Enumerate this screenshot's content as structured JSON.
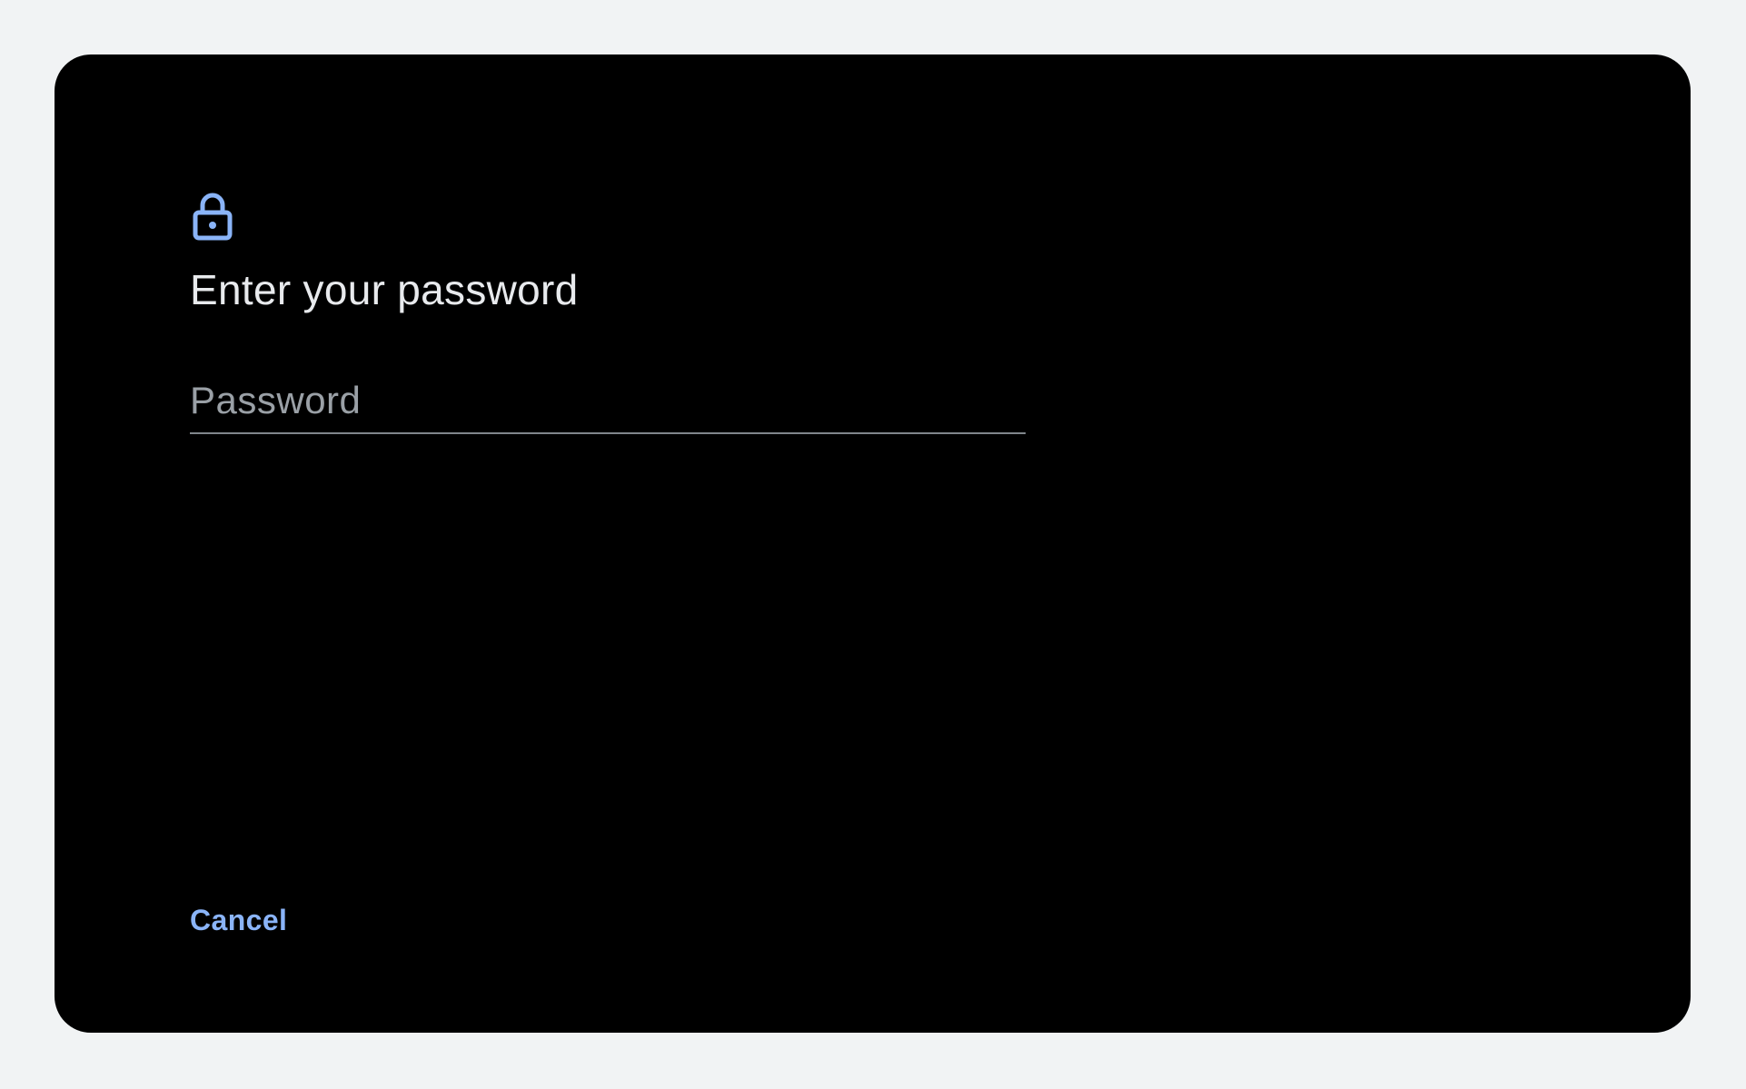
{
  "dialog": {
    "icon": "lock-icon",
    "title": "Enter your password",
    "password_field": {
      "placeholder": "Password",
      "value": ""
    },
    "cancel_label": "Cancel"
  },
  "colors": {
    "page_background": "#f1f3f4",
    "dialog_background": "#000000",
    "accent": "#8ab4f8",
    "title_text": "#e8eaed",
    "placeholder_text": "#9aa0a6",
    "underline": "#80868b"
  }
}
